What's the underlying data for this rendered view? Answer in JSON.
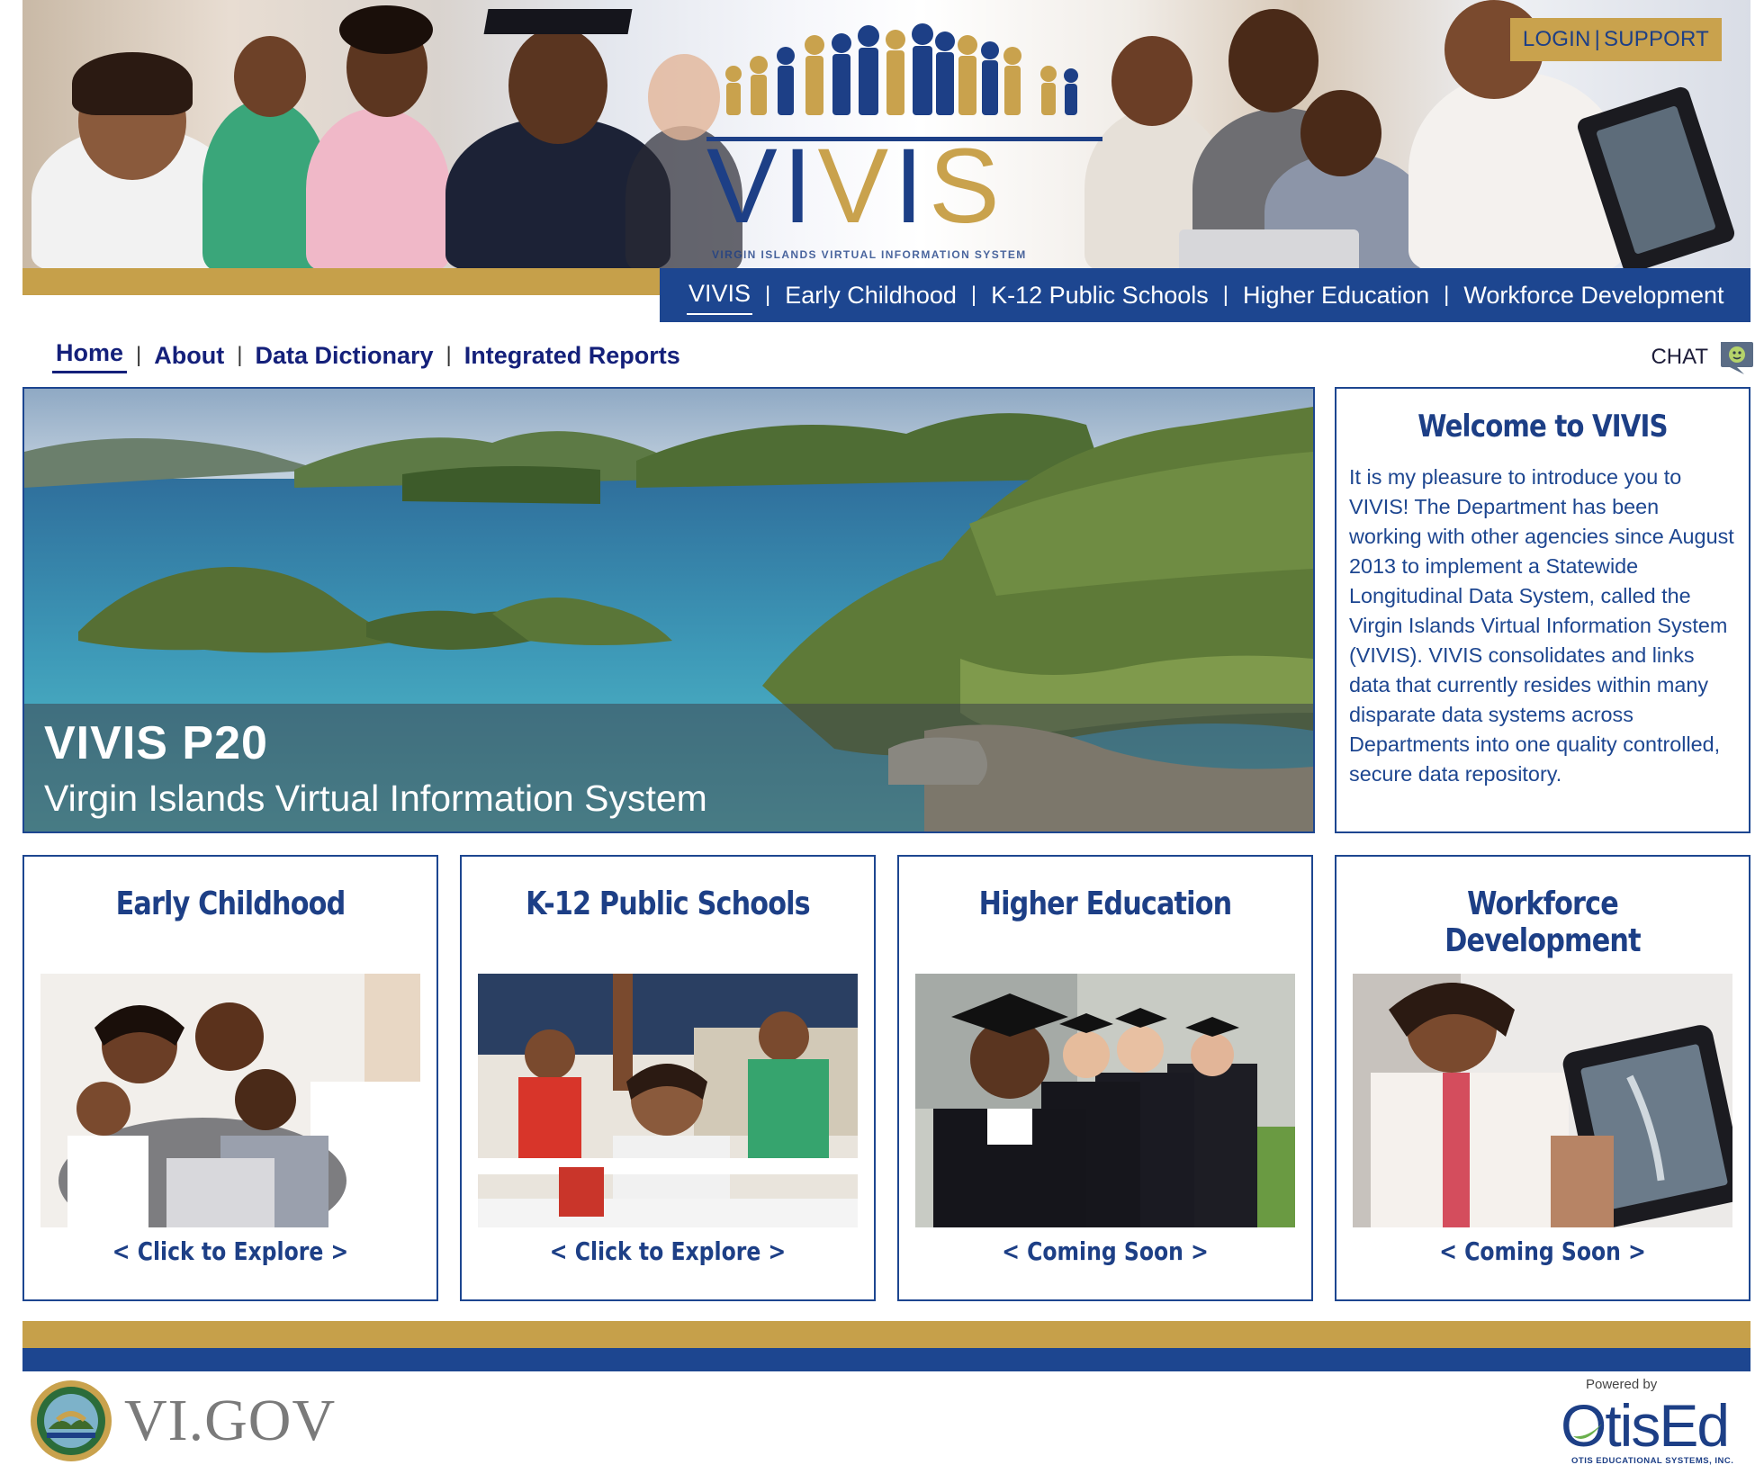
{
  "header": {
    "logo_text": "VIVIS",
    "logo_subtitle": "VIRGIN ISLANDS VIRTUAL INFORMATION SYSTEM",
    "login_label": "LOGIN",
    "support_label": "SUPPORT",
    "separator": "|"
  },
  "domain_nav": {
    "items": [
      {
        "label": "VIVIS",
        "active": true
      },
      {
        "label": "Early Childhood",
        "active": false
      },
      {
        "label": "K-12 Public Schools",
        "active": false
      },
      {
        "label": "Higher Education",
        "active": false
      },
      {
        "label": "Workforce Development",
        "active": false
      }
    ],
    "separator": "|"
  },
  "sub_nav": {
    "items": [
      {
        "label": "Home",
        "active": true
      },
      {
        "label": "About",
        "active": false
      },
      {
        "label": "Data Dictionary",
        "active": false
      },
      {
        "label": "Integrated Reports",
        "active": false
      }
    ],
    "separator": "|"
  },
  "chat": {
    "label": "CHAT",
    "icon": "chat-bubble-icon"
  },
  "hero": {
    "title": "VIVIS P20",
    "subtitle": "Virgin Islands Virtual Information System"
  },
  "welcome": {
    "title": "Welcome to VIVIS",
    "body": "It is my pleasure to introduce you to VIVIS! The Department has been working with other agencies since August 2013 to implement a Statewide Longitudinal Data System, called the Virgin Islands Virtual Information System (VIVIS).  VIVIS consolidates and links data that currently resides within many disparate data systems across Departments into one quality controlled, secure data repository."
  },
  "cards": [
    {
      "title": "Early Childhood",
      "link": "< Click to Explore >"
    },
    {
      "title": "K-12 Public Schools",
      "link": "< Click to Explore >"
    },
    {
      "title": "Higher Education",
      "link": "< Coming Soon >"
    },
    {
      "title": "Workforce Development",
      "link": "< Coming Soon >"
    }
  ],
  "footer": {
    "vigov_label": "VI.GOV",
    "otis_powered": "Powered by",
    "otis_brand": "OtisEd",
    "otis_sub": "OTIS EDUCATIONAL SYSTEMS, INC."
  },
  "colors": {
    "navy": "#1d4690",
    "gold": "#c6a04a",
    "text_blue": "#1d3f86"
  }
}
